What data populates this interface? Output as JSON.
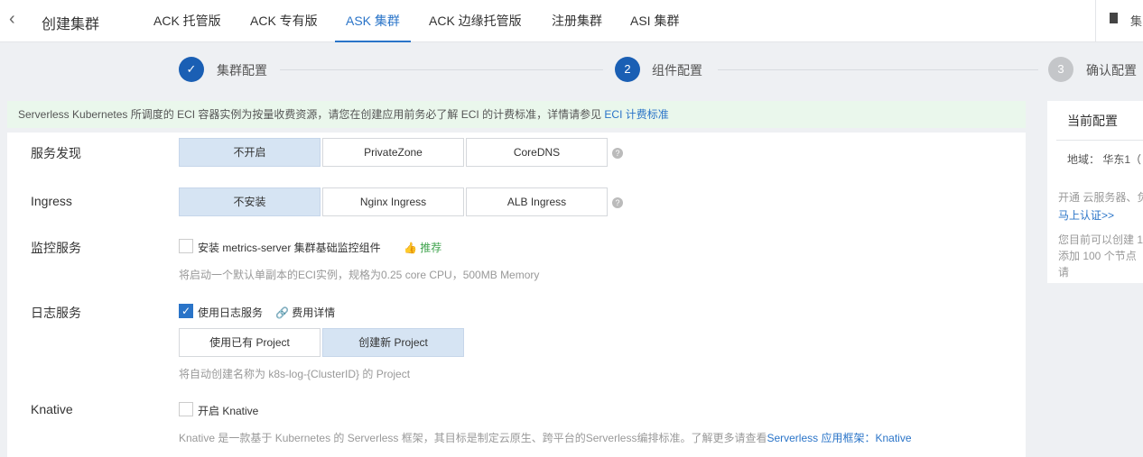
{
  "header": {
    "title": "创建集群",
    "tabs": [
      {
        "label": "ACK 托管版"
      },
      {
        "label": "ACK 专有版"
      },
      {
        "label": "ASK 集群"
      },
      {
        "label": "ACK 边缘托管版"
      },
      {
        "label": "注册集群"
      },
      {
        "label": "ASI 集群"
      }
    ],
    "active_tab": "ASK 集群",
    "right_text": "集"
  },
  "steps": [
    {
      "num": "✓",
      "label": "集群配置",
      "state": "done"
    },
    {
      "num": "2",
      "label": "组件配置",
      "state": "current"
    },
    {
      "num": "3",
      "label": "确认配置",
      "state": "pending"
    }
  ],
  "banner": {
    "text": "Serverless Kubernetes 所调度的 ECI 容器实例为按量收费资源，请您在创建应用前务必了解 ECI 的计费标准，详情请参见 ",
    "link": "ECI 计费标准"
  },
  "form": {
    "service_discovery": {
      "label": "服务发现",
      "options": [
        "不开启",
        "PrivateZone",
        "CoreDNS"
      ],
      "selected": "不开启"
    },
    "ingress": {
      "label": "Ingress",
      "options": [
        "不安装",
        "Nginx Ingress",
        "ALB Ingress"
      ],
      "selected": "不安装"
    },
    "monitoring": {
      "label": "监控服务",
      "checkbox": "安装 metrics-server 集群基础监控组件",
      "checked": false,
      "badge": "推荐",
      "hint": "将启动一个默认单副本的ECI实例，规格为0.25 core CPU，500MB Memory"
    },
    "logging": {
      "label": "日志服务",
      "checkbox": "使用日志服务",
      "checked": true,
      "link": "费用详情",
      "options": [
        "使用已有 Project",
        "创建新 Project"
      ],
      "selected": "创建新 Project",
      "hint": "将自动创建名称为 k8s-log-{ClusterID} 的 Project"
    },
    "knative": {
      "label": "Knative",
      "checkbox": "开启 Knative",
      "checked": false,
      "hint": "Knative 是一款基于 Kubernetes 的 Serverless 框架，其目标是制定云原生、跨平台的Serverless编排标准。了解更多请查看",
      "link": "Serverless 应用框架：Knative"
    }
  },
  "side": {
    "title": "当前配置",
    "region": "地域：  华东1（",
    "line1": "开通 云服务器、负",
    "link": "马上认证>>",
    "line2": "您目前可以创建 1",
    "line3": "添加 100 个节点",
    "line4": "请"
  },
  "colors": {
    "accent": "#2a74c8",
    "success": "#3fa34d"
  }
}
